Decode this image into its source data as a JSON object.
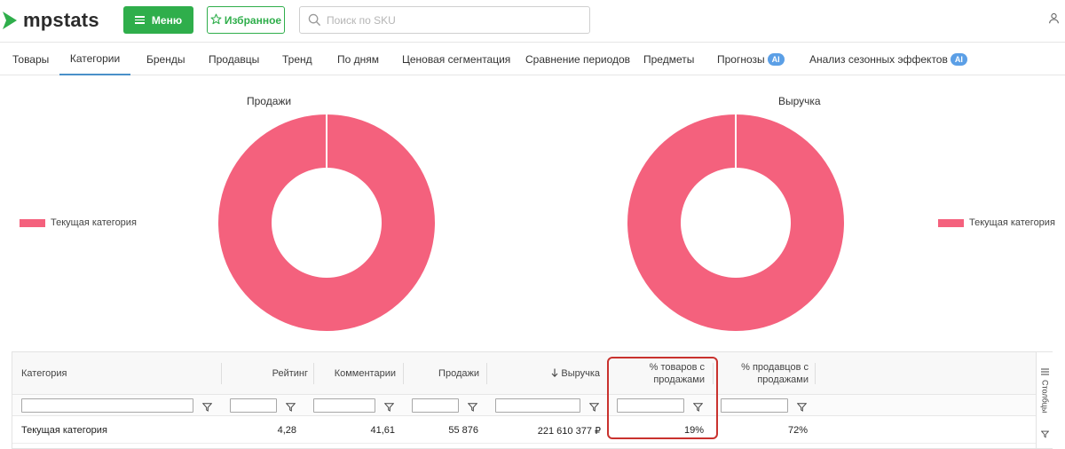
{
  "header": {
    "logo_text": "mpstats",
    "menu_label": "Меню",
    "favorites_label": "Избранное",
    "search_placeholder": "Поиск по SKU",
    "search_value": ""
  },
  "tabs": [
    {
      "label": "Товары",
      "active": false,
      "ai": false
    },
    {
      "label": "Категории",
      "active": true,
      "ai": false
    },
    {
      "label": "Бренды",
      "active": false,
      "ai": false
    },
    {
      "label": "Продавцы",
      "active": false,
      "ai": false
    },
    {
      "label": "Тренд",
      "active": false,
      "ai": false
    },
    {
      "label": "По дням",
      "active": false,
      "ai": false
    },
    {
      "label": "Ценовая сегментация",
      "active": false,
      "ai": false
    },
    {
      "label": "Сравнение периодов",
      "active": false,
      "ai": false
    },
    {
      "label": "Предметы",
      "active": false,
      "ai": false
    },
    {
      "label": "Прогнозы",
      "active": false,
      "ai": true
    },
    {
      "label": "Анализ сезонных эффектов",
      "active": false,
      "ai": true
    }
  ],
  "ai_badge": "AI",
  "charts": {
    "sales": {
      "title": "Продажи",
      "legend": "Текущая категория",
      "share": 1.0
    },
    "revenue": {
      "title": "Выручка",
      "legend": "Текущая категория",
      "share": 1.0
    },
    "color": "#f4617d"
  },
  "table": {
    "columns": [
      {
        "label": "Категория"
      },
      {
        "label": "Рейтинг"
      },
      {
        "label": "Комментарии"
      },
      {
        "label": "Продажи"
      },
      {
        "label": "Выручка",
        "sort": "desc"
      },
      {
        "label": "% товаров с продажами"
      },
      {
        "label": "% продавцов с продажами"
      }
    ],
    "rows": [
      [
        "Текущая категория",
        "4,28",
        "41,61",
        "55 876",
        "221 610 377 ₽",
        "19%",
        "72%"
      ]
    ],
    "side_columns_label": "Столбцы"
  },
  "colors": {
    "accent_green": "#2fae4b",
    "chart_pink": "#f4617d",
    "highlight_red": "#c9322e",
    "tab_active": "#4a90c9"
  }
}
